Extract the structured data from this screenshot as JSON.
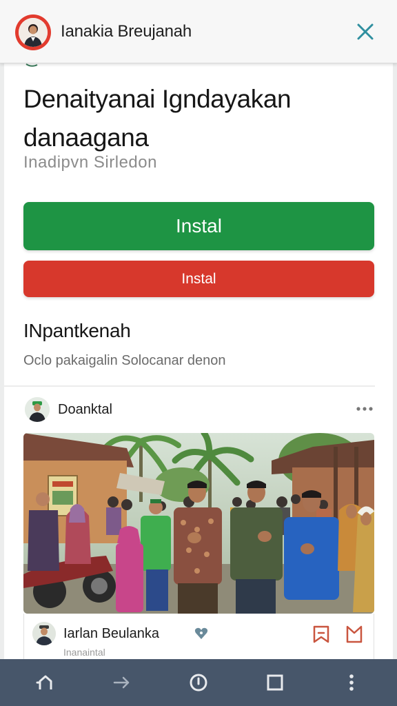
{
  "header": {
    "title": "Ianakia Breujanah",
    "avatar_icon": "person-avatar-icon",
    "close_icon": "close-icon",
    "accent_color": "#e23b2e"
  },
  "main": {
    "headline": "Denaityanai Igndayakan danaagana",
    "subtitle": "Inadipvn Sirledon",
    "primary_button": {
      "label": "Instal",
      "color": "#1e9444"
    },
    "secondary_button": {
      "label": "Instal",
      "color": "#d7382c"
    },
    "section_title": "INpantkenah",
    "section_subtitle": "Oclo pakaigalin Solocanar denon"
  },
  "post": {
    "author": "Doanktal",
    "more_icon": "more-horizontal-icon",
    "photo_description_icon": "community-photo",
    "card": {
      "title": "Iarlan Beulanka",
      "subtitle": "Inanaintal",
      "heart_icon": "heart-icon",
      "bookmark_icons": [
        "bookmark-icon",
        "bookmark-outline-icon"
      ],
      "icon_color": "#c9553f"
    }
  },
  "navbar": {
    "items": [
      "back-icon",
      "forward-icon",
      "home-circle-icon",
      "tabs-square-icon",
      "menu-dots-icon"
    ],
    "background": "#47566a"
  }
}
